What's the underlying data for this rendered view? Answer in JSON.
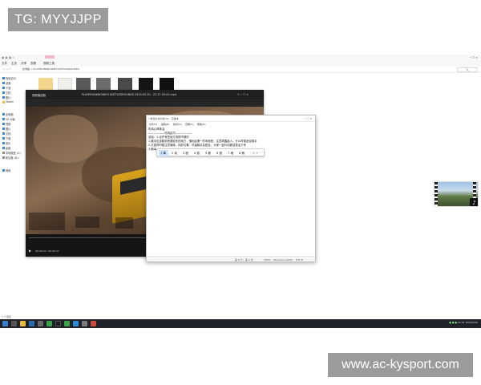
{
  "watermark_top": "TG: MYYJJPP",
  "watermark_bottom": "www.ac-kysport.com",
  "explorer": {
    "ribbon_tabs": [
      "文件",
      "主页",
      "共享",
      "查看",
      "视频工具"
    ],
    "address": "此电脑  >  PLAYERUNKNOWN'S BATTLEGROUNDS",
    "nav_items": [
      "快速访问",
      "桌面",
      "下载",
      "文档",
      "图片",
      "Steam",
      "此电脑",
      "3D 对象",
      "视频",
      "图片",
      "文档",
      "下载",
      "音乐",
      "桌面",
      "本地磁盘 (C:)",
      "新加卷 (D:)",
      "网络"
    ],
    "status": "7 个项目"
  },
  "player": {
    "title": "PLAYERUNKNOWN'S BATTLEGROUNDS 2019.05.20 - 22.27.03.02.mp4",
    "app_name": "视频播放器",
    "time_text": "00:00:07 / 00:00:31"
  },
  "notepad": {
    "title": "*新建文本文档.txt - 记事本",
    "menu": [
      "文件(F)",
      "编辑(E)",
      "格式(O)",
      "查看(V)",
      "帮助(H)"
    ],
    "lines": [
      "吃鸡心得体会",
      "——————吃鸡技巧——————",
      "总结：1.也许有些地方说得不够好",
      "1.跳伞应该跳到资源较多的地方，落地后第一时间找枪，注意周围敌人。什么时候适合跳伞",
      "2.打架的时候注意掩体，找好位置，尽量和队友配合，大家一起行动更容易活下来",
      "3.跑毒"
    ],
    "ime_candidates": [
      "1 毒",
      "2 读",
      "3 度",
      "4 独",
      "5 都",
      "6 渡",
      "7 堵",
      "8 赌"
    ],
    "status": [
      "第 6 行，第 4 列",
      "100%",
      "Windows (CRLF)",
      "UTF-8"
    ]
  },
  "taskbar": {
    "time": "22:31",
    "date": "2019/5/20"
  },
  "colors": {
    "accent": "#3b7fd1",
    "taskbar": "#1f2329",
    "watermark": "#9b9b9b"
  }
}
